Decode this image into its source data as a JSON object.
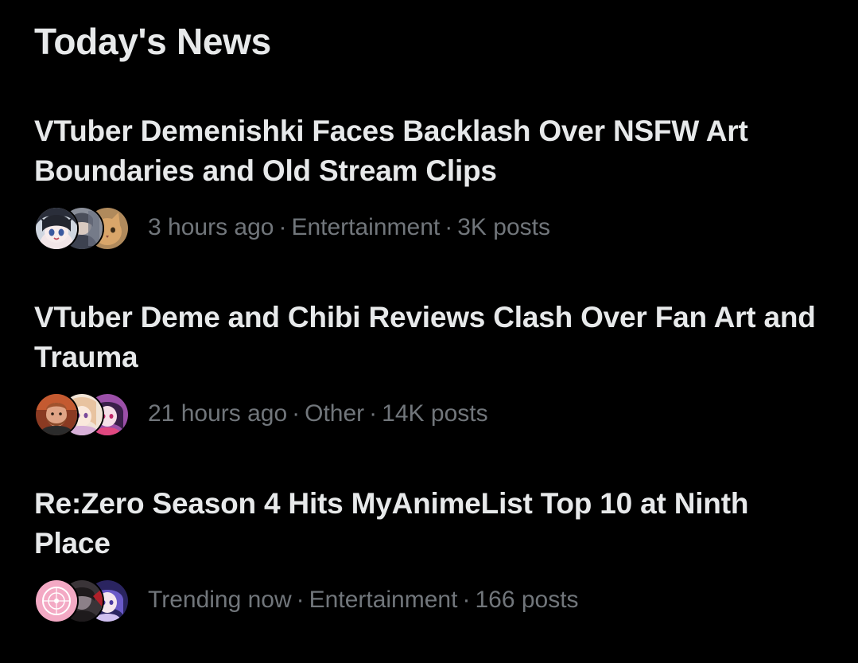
{
  "section": {
    "title": "Today's News"
  },
  "news": [
    {
      "headline": "VTuber Demenishki Faces Backlash Over NSFW Art Boundaries and Old Stream Clips",
      "time": "3 hours ago",
      "category": "Entertainment",
      "posts": "3K posts",
      "separator": "·",
      "avatars": [
        "anime-girl-avatar",
        "anime-character-avatar",
        "cat-avatar"
      ]
    },
    {
      "headline": "VTuber Deme and Chibi Reviews Clash Over Fan Art and Trauma",
      "time": "21 hours ago",
      "category": "Other",
      "posts": "14K posts",
      "separator": "·",
      "avatars": [
        "bearded-man-avatar",
        "anime-art-avatar",
        "anime-pink-avatar"
      ]
    },
    {
      "headline": "Re:Zero Season 4 Hits MyAnimeList Top 10 at Ninth Place",
      "time": "Trending now",
      "category": "Entertainment",
      "posts": "166 posts",
      "separator": "·",
      "avatars": [
        "pink-emblem-avatar",
        "dark-character-avatar",
        "anime-purple-avatar"
      ]
    }
  ],
  "colors": {
    "background": "#000000",
    "primary_text": "#e7e9ea",
    "secondary_text": "#71767b"
  }
}
